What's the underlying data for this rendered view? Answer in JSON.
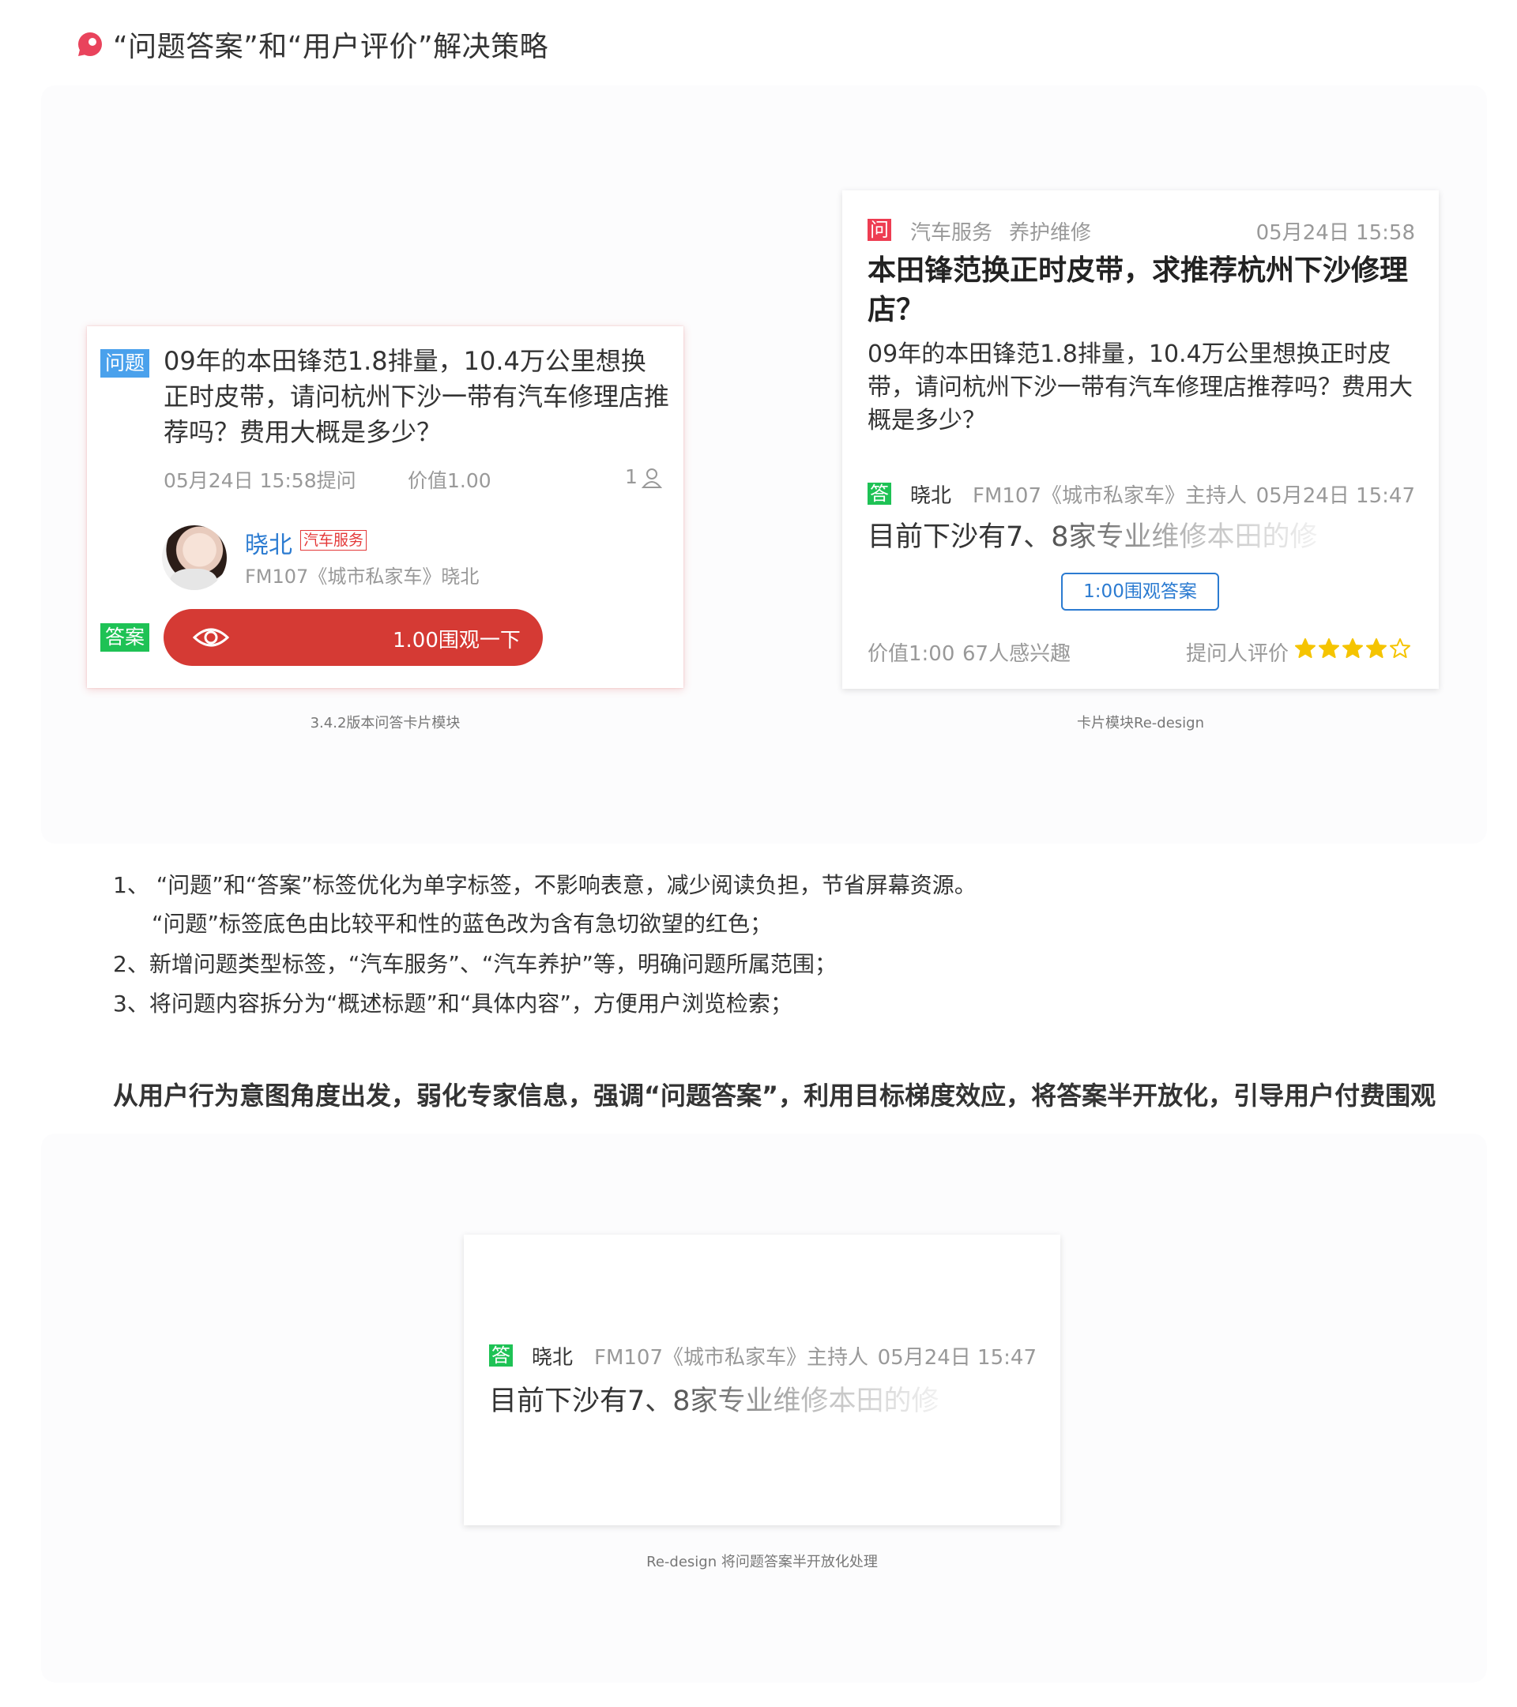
{
  "header": {
    "title": "“问题答案”和“用户评价”解决策略",
    "icon": "red-location-pin-icon",
    "accent_color": "#e9435c"
  },
  "old_card": {
    "question_tag": "问题",
    "title": "09年的本田锋范1.8排量，10.4万公里想换正时皮带，请问杭州下沙一带有汽车修理店推荐吗？费用大概是多少？",
    "time": "05月24日 15:58提问",
    "value": "价值1.00",
    "count": "1",
    "expert_name": "晓北",
    "expert_tag": "汽车服务",
    "expert_desc": "FM107《城市私家车》晓北",
    "answer_tag": "答案",
    "view_button": "1.00围观一下",
    "button_color": "#d53a34"
  },
  "new_card": {
    "question_tag": "问",
    "category1": "汽车服务",
    "category2": "养护维修",
    "question_time": "05月24日 15:58",
    "title": "本田锋范换正时皮带，求推荐杭州下沙修理店？",
    "body": "09年的本田锋范1.8排量，10.4万公里想换正时皮带，请问杭州下沙一带有汽车修理店推荐吗？费用大概是多少？",
    "answer_tag": "答",
    "answerer": "晓北",
    "answerer_desc": "FM107《城市私家车》主持人",
    "answer_time": "05月24日 15:47",
    "answer_preview": "目前下沙有7、8家专业维修本田的修",
    "answer_button": "1:00围观答案",
    "value": "价值1:00",
    "interest": "67人感兴趣",
    "evaluation_label": "提问人评价",
    "rating": 4.5,
    "rating_max": 5,
    "star_color": "#f5c400"
  },
  "captions": {
    "old": "3.4.2版本问答卡片模块",
    "new": "卡片模块Re-design",
    "bottom": "Re-design 将问题答案半开放化处理"
  },
  "list": {
    "item1": "1、 “问题”和“答案”标签优化为单字标签，不影响表意，减少阅读负担，节省屏幕资源。",
    "item1b": "“问题”标签底色由比较平和性的蓝色改为含有急切欲望的红色；",
    "item2": "2、新增问题类型标签，“汽车服务”、“汽车养护”等，明确问题所属范围；",
    "item3": "3、将问题内容拆分为“概述标题”和“具体内容”，方便用户浏览检索；"
  },
  "summary": "从用户行为意图角度出发，弱化专家信息，强调“问题答案”，利用目标梯度效应，将答案半开放化，引导用户付费围观",
  "bottom_card": {
    "answer_tag": "答",
    "answerer": "晓北",
    "answerer_desc": "FM107《城市私家车》主持人",
    "answer_time": "05月24日 15:47",
    "answer_preview": "目前下沙有7、8家专业维修本田的修"
  }
}
